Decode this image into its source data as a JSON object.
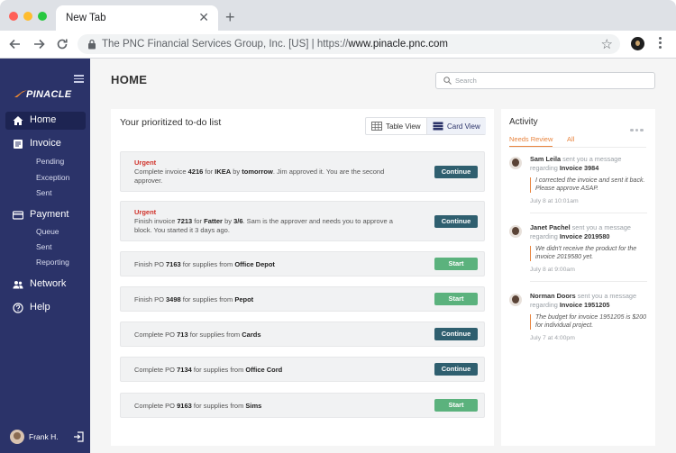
{
  "browser": {
    "tab_title": "New Tab",
    "url_prefix": "The PNC Financial Services Group, Inc. [US] | https://",
    "url_domain": "www.pinacle.pnc.com"
  },
  "sidebar": {
    "logo": "PINACLE",
    "nav": [
      {
        "label": "Home",
        "icon": "home-icon",
        "active": true
      },
      {
        "label": "Invoice",
        "icon": "invoice-icon",
        "sub": [
          "Pending",
          "Exception",
          "Sent"
        ]
      },
      {
        "label": "Payment",
        "icon": "payment-icon",
        "sub": [
          "Queue",
          "Sent",
          "Reporting"
        ]
      },
      {
        "label": "Network",
        "icon": "network-icon"
      },
      {
        "label": "Help",
        "icon": "help-icon"
      }
    ],
    "user_name": "Frank H."
  },
  "header": {
    "title": "HOME",
    "search_placeholder": "Search"
  },
  "todo": {
    "title": "Your prioritized to-do list",
    "view_table": "Table View",
    "view_card": "Card View",
    "urgent_label": "Urgent",
    "continue_label": "Continue",
    "start_label": "Start",
    "tasks": [
      {
        "urgent": true,
        "line1": [
          "Complete invoice ",
          "4216",
          " for ",
          "IKEA",
          " by ",
          "tomorrow",
          ". Jim approved it. You are the second"
        ],
        "line2": "approver.",
        "action": "continue"
      },
      {
        "urgent": true,
        "line1": [
          "Finish invoice ",
          "7213",
          " for ",
          "Fatter",
          " by ",
          "3/6",
          ". Sam is the approver and needs you to approve a"
        ],
        "line2": "block. You started it 3 days ago.",
        "action": "continue"
      },
      {
        "urgent": false,
        "line1": [
          "Finish PO ",
          "7163",
          " for supplies from ",
          "Office Depot"
        ],
        "action": "start"
      },
      {
        "urgent": false,
        "line1": [
          "Finish PO ",
          "3498",
          " for supplies from ",
          "Pepot"
        ],
        "action": "start"
      },
      {
        "urgent": false,
        "line1": [
          "Complete PO ",
          "713",
          " for supplies from ",
          "Cards"
        ],
        "action": "continue"
      },
      {
        "urgent": false,
        "line1": [
          "Complete PO ",
          "7134",
          " for supplies from ",
          "Office Cord"
        ],
        "action": "continue"
      },
      {
        "urgent": false,
        "line1": [
          "Complete PO ",
          "9163",
          " for supplies from ",
          "Sims"
        ],
        "action": "start"
      }
    ]
  },
  "activity": {
    "title": "Activity",
    "tab_needs_review": "Needs Review",
    "tab_all": "All",
    "messages": [
      {
        "name": "Sam Leila",
        "action": " sent you a message",
        "regarding": "regarding ",
        "invoice": "Invoice 3984",
        "quote": "I corrected the invoice and sent it back. Please approve ASAP.",
        "time": "July 8 at 10:01am"
      },
      {
        "name": "Janet Pachel",
        "action": " sent you a message",
        "regarding": "regarding ",
        "invoice": "Invoice 2019580",
        "quote": "We didn't receive the product for the invoice 2019580 yet.",
        "time": "July 8 at 9:00am"
      },
      {
        "name": "Norman Doors",
        "action": " sent you a message",
        "regarding": "regarding ",
        "invoice": "Invoice 1951205",
        "quote": "The budget for invoice 1951205 is $200 for individual project.",
        "time": "July 7 at 4:00pm"
      }
    ]
  },
  "colors": {
    "sidebar_bg": "#2b3369",
    "continue_btn": "#2f5f6f",
    "start_btn": "#5bb27d",
    "urgent": "#d0322a",
    "accent": "#e8843e"
  }
}
